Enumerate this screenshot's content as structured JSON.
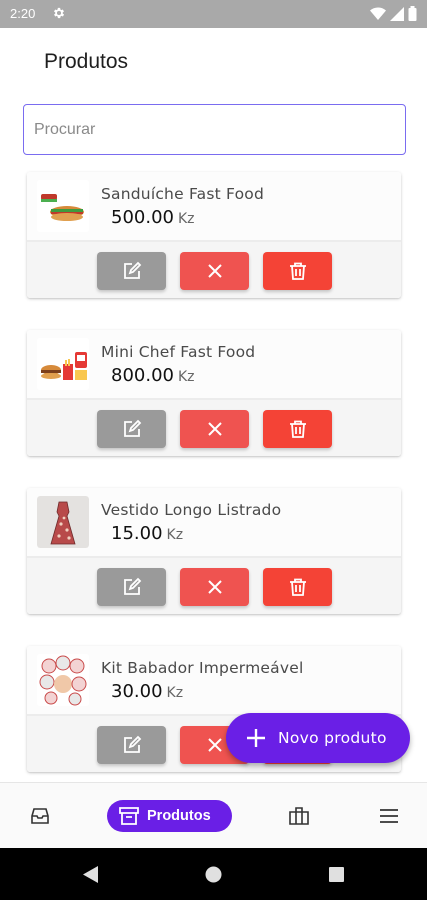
{
  "status_bar": {
    "time": "2:20"
  },
  "page": {
    "title": "Produtos"
  },
  "search": {
    "placeholder": "Procurar",
    "value": ""
  },
  "products": [
    {
      "name": "Sanduíche Fast Food",
      "price": "500.00",
      "currency": "Kz",
      "thumb_icon": "sandwich-image"
    },
    {
      "name": "Mini Chef Fast Food",
      "price": "800.00",
      "currency": "Kz",
      "thumb_icon": "fastfood-combo-image"
    },
    {
      "name": "Vestido Longo Listrado",
      "price": "15.00",
      "currency": "Kz",
      "thumb_icon": "dress-image"
    },
    {
      "name": "Kit Babador Impermeável",
      "price": "30.00",
      "currency": "Kz",
      "thumb_icon": "bib-kit-image"
    }
  ],
  "actions": {
    "edit_icon": "edit-icon",
    "cancel_icon": "close-icon",
    "delete_icon": "trash-icon"
  },
  "fab": {
    "label": "Novo produto",
    "icon": "plus-icon"
  },
  "bottom_nav": {
    "items": [
      {
        "id": "inbox",
        "icon": "inbox-icon"
      },
      {
        "id": "produtos",
        "label": "Produtos",
        "icon": "archive-box-icon",
        "active": true
      },
      {
        "id": "briefcase",
        "icon": "briefcase-icon"
      },
      {
        "id": "menu",
        "icon": "menu-icon"
      }
    ]
  },
  "colors": {
    "accent": "#6a1fe6",
    "edit_button": "#9a9a9a",
    "cancel_button": "#ef5350",
    "delete_button": "#f44336",
    "search_border": "#7a6cf0"
  }
}
